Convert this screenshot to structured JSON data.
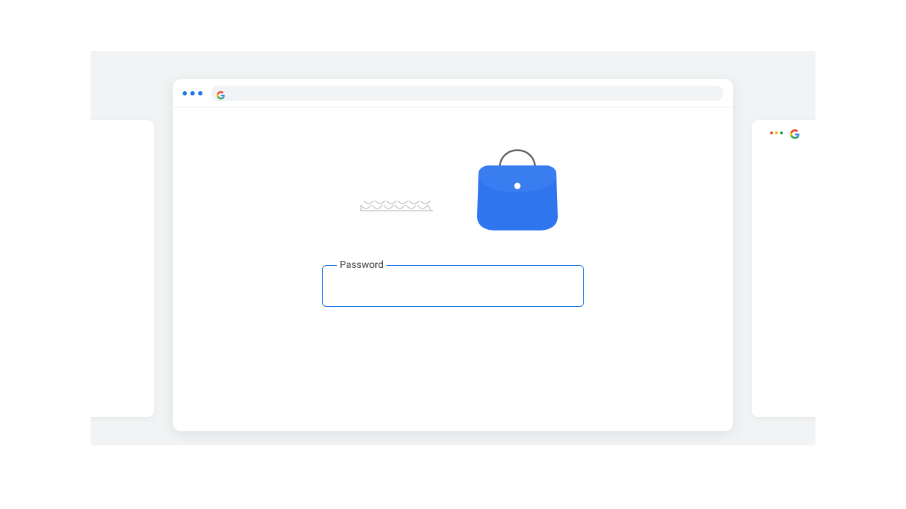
{
  "colors": {
    "accent": "#1a73e8",
    "bag": "#2f75ee",
    "outline": "#5f6368",
    "page_bg": "#f1f3f4"
  },
  "background_windows": {
    "has_dots": true
  },
  "browser": {
    "traffic_color": "#1a73e8",
    "url_value": ""
  },
  "illustration": {
    "left_item": "egg-tray",
    "right_item": "handbag"
  },
  "form": {
    "password_label": "Password",
    "password_value": ""
  }
}
